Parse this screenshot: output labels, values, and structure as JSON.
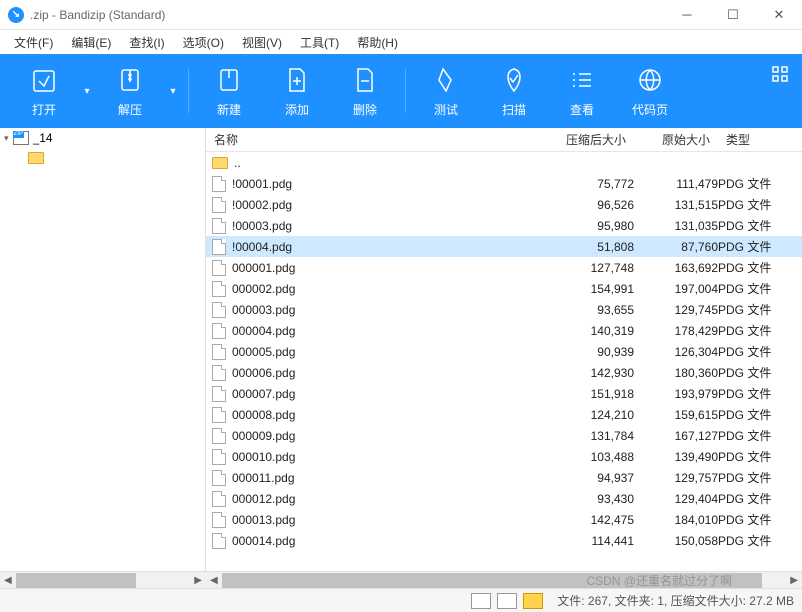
{
  "titlebar": {
    "filename_suffix": ".zip - Bandizip (Standard)"
  },
  "menu": {
    "file": "文件(F)",
    "edit": "编辑(E)",
    "find": "查找(I)",
    "options": "选项(O)",
    "view": "视图(V)",
    "tools": "工具(T)",
    "help": "帮助(H)"
  },
  "toolbar": {
    "open": "打开",
    "extract": "解压",
    "new": "新建",
    "add": "添加",
    "delete": "删除",
    "test": "测试",
    "scan": "扫描",
    "view": "查看",
    "codepage": "代码页"
  },
  "tree": {
    "root_suffix": "_14"
  },
  "columns": {
    "name": "名称",
    "compressed": "压缩后大小",
    "original": "原始大小",
    "type": "类型"
  },
  "parent_dir": "..",
  "type_label": "PDG 文件",
  "files": [
    {
      "name": "!00001.pdg",
      "comp": "75,772",
      "orig": "111,479",
      "sel": false
    },
    {
      "name": "!00002.pdg",
      "comp": "96,526",
      "orig": "131,515",
      "sel": false
    },
    {
      "name": "!00003.pdg",
      "comp": "95,980",
      "orig": "131,035",
      "sel": false
    },
    {
      "name": "!00004.pdg",
      "comp": "51,808",
      "orig": "87,760",
      "sel": true
    },
    {
      "name": "000001.pdg",
      "comp": "127,748",
      "orig": "163,692",
      "sel": false
    },
    {
      "name": "000002.pdg",
      "comp": "154,991",
      "orig": "197,004",
      "sel": false
    },
    {
      "name": "000003.pdg",
      "comp": "93,655",
      "orig": "129,745",
      "sel": false
    },
    {
      "name": "000004.pdg",
      "comp": "140,319",
      "orig": "178,429",
      "sel": false
    },
    {
      "name": "000005.pdg",
      "comp": "90,939",
      "orig": "126,304",
      "sel": false
    },
    {
      "name": "000006.pdg",
      "comp": "142,930",
      "orig": "180,360",
      "sel": false
    },
    {
      "name": "000007.pdg",
      "comp": "151,918",
      "orig": "193,979",
      "sel": false
    },
    {
      "name": "000008.pdg",
      "comp": "124,210",
      "orig": "159,615",
      "sel": false
    },
    {
      "name": "000009.pdg",
      "comp": "131,784",
      "orig": "167,127",
      "sel": false
    },
    {
      "name": "000010.pdg",
      "comp": "103,488",
      "orig": "139,490",
      "sel": false
    },
    {
      "name": "000011.pdg",
      "comp": "94,937",
      "orig": "129,757",
      "sel": false
    },
    {
      "name": "000012.pdg",
      "comp": "93,430",
      "orig": "129,404",
      "sel": false
    },
    {
      "name": "000013.pdg",
      "comp": "142,475",
      "orig": "184,010",
      "sel": false
    },
    {
      "name": "000014.pdg",
      "comp": "114,441",
      "orig": "150,058",
      "sel": false
    }
  ],
  "status": {
    "text": "文件: 267, 文件夹: 1, 压缩文件大小: 27.2 MB"
  },
  "watermark": "CSDN @还重名就过分了啊"
}
